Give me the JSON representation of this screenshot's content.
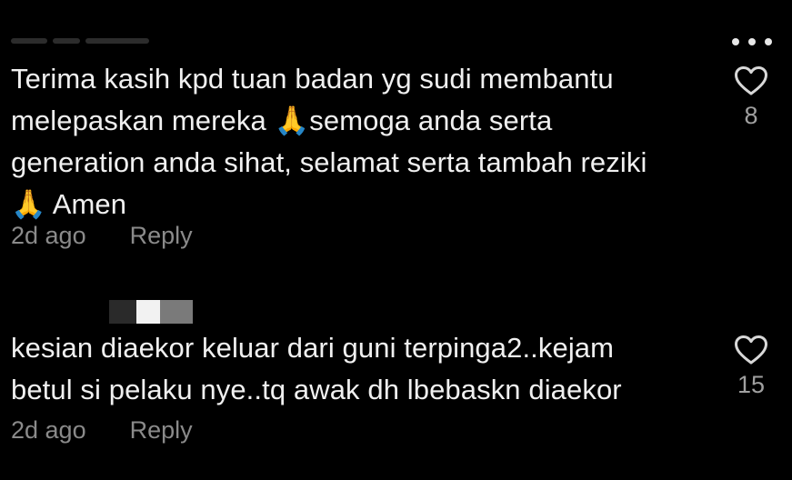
{
  "comments": [
    {
      "text": "Terima kasih kpd tuan badan yg sudi membantu\nmelepaskan mereka 🙏semoga anda serta\ngeneration anda sihat, selamat serta tambah reziki\n🙏 Amen",
      "time": "2d ago",
      "reply_label": "Reply",
      "like_count": "8",
      "like_icon": "heart-outline-icon"
    },
    {
      "text": "kesian diaekor keluar dari guni terpinga2..kejam\nbetul si pelaku nye..tq awak dh lbebaskn diaekor",
      "time": "2d ago",
      "reply_label": "Reply",
      "like_count": "15",
      "like_icon": "heart-outline-icon"
    }
  ],
  "more_icon": "more-horizontal-icon",
  "colors": {
    "background": "#000000",
    "text": "#f0f0f0",
    "meta": "#8a8a8a",
    "icon": "#d8d8d8"
  }
}
